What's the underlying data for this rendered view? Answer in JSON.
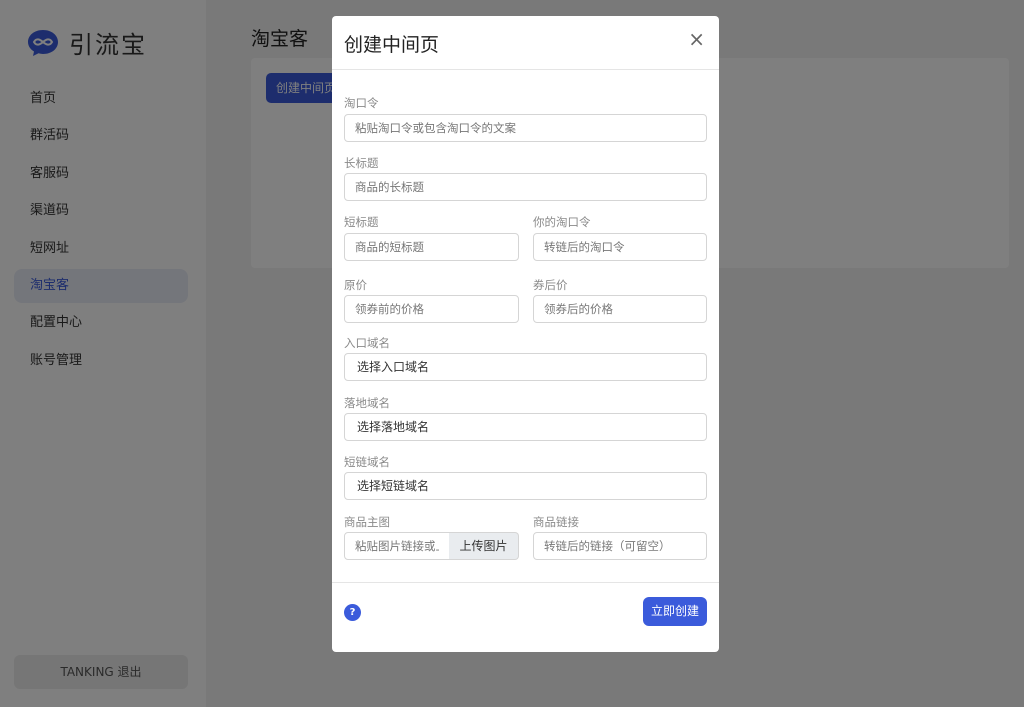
{
  "app": {
    "name": "引流宝",
    "logo_icon": "infinity-chat-icon",
    "brand_color": "#3b5bdb"
  },
  "sidebar": {
    "items": [
      {
        "label": "首页",
        "active": false
      },
      {
        "label": "群活码",
        "active": false
      },
      {
        "label": "客服码",
        "active": false
      },
      {
        "label": "渠道码",
        "active": false
      },
      {
        "label": "短网址",
        "active": false
      },
      {
        "label": "淘宝客",
        "active": true
      },
      {
        "label": "配置中心",
        "active": false
      },
      {
        "label": "账号管理",
        "active": false
      }
    ],
    "logout_label": "TANKING  退出"
  },
  "main": {
    "title": "淘宝客",
    "create_button": "创建中间页"
  },
  "modal": {
    "title": "创建中间页",
    "close_icon": "×",
    "fields": {
      "taokouling": {
        "label": "淘口令",
        "placeholder": "粘贴淘口令或包含淘口令的文案"
      },
      "long_title": {
        "label": "长标题",
        "placeholder": "商品的长标题"
      },
      "short_title": {
        "label": "短标题",
        "placeholder": "商品的短标题"
      },
      "your_taokouling": {
        "label": "你的淘口令",
        "placeholder": "转链后的淘口令"
      },
      "original_price": {
        "label": "原价",
        "placeholder": "领券前的价格"
      },
      "coupon_price": {
        "label": "券后价",
        "placeholder": "领券后的价格"
      },
      "entry_domain": {
        "label": "入口域名",
        "value": "选择入口域名"
      },
      "landing_domain": {
        "label": "落地域名",
        "value": "选择落地域名"
      },
      "short_domain": {
        "label": "短链域名",
        "value": "选择短链域名"
      },
      "main_image": {
        "label": "商品主图",
        "placeholder": "粘贴图片链接或上传",
        "upload_label": "上传图片"
      },
      "product_link": {
        "label": "商品链接",
        "placeholder": "转链后的链接（可留空）"
      }
    },
    "help_icon": "?",
    "submit_label": "立即创建"
  }
}
